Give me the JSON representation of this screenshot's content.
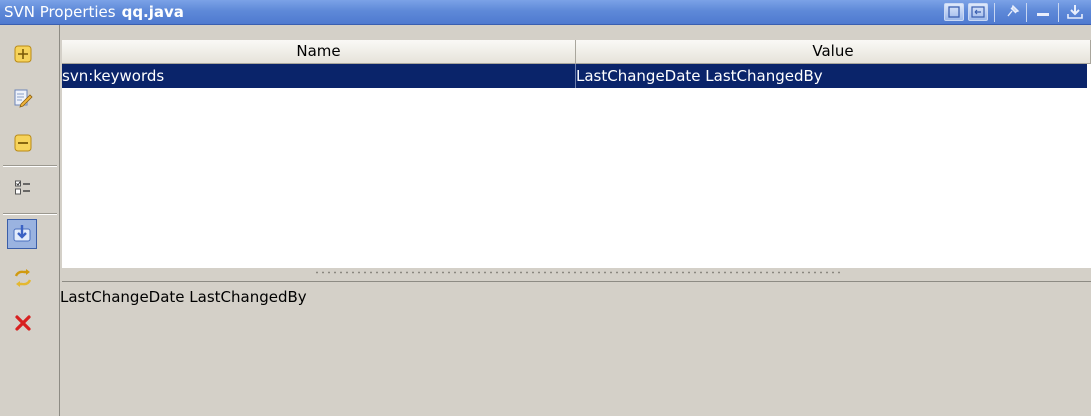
{
  "window": {
    "title": "SVN Properties",
    "file_name": "qq.java",
    "title_buttons": [
      "maximize-window-icon",
      "restore-window-icon",
      "pin-icon",
      "minimize-icon",
      "dock-icon"
    ]
  },
  "toolbar": {
    "items": [
      "add-property-icon",
      "edit-property-icon",
      "remove-property-icon",
      "select-all-icon",
      "update-icon",
      "refresh-icon",
      "close-icon"
    ]
  },
  "table": {
    "columns": [
      "Name",
      "Value"
    ],
    "rows": [
      {
        "name": "svn:keywords",
        "value": "LastChangeDate LastChangedBy"
      }
    ]
  },
  "value_editor": {
    "text": "LastChangeDate LastChangedBy"
  },
  "colors": {
    "title_bar": "#5e89d8",
    "selection": "#0a246a",
    "panel": "#d4d0c8"
  }
}
